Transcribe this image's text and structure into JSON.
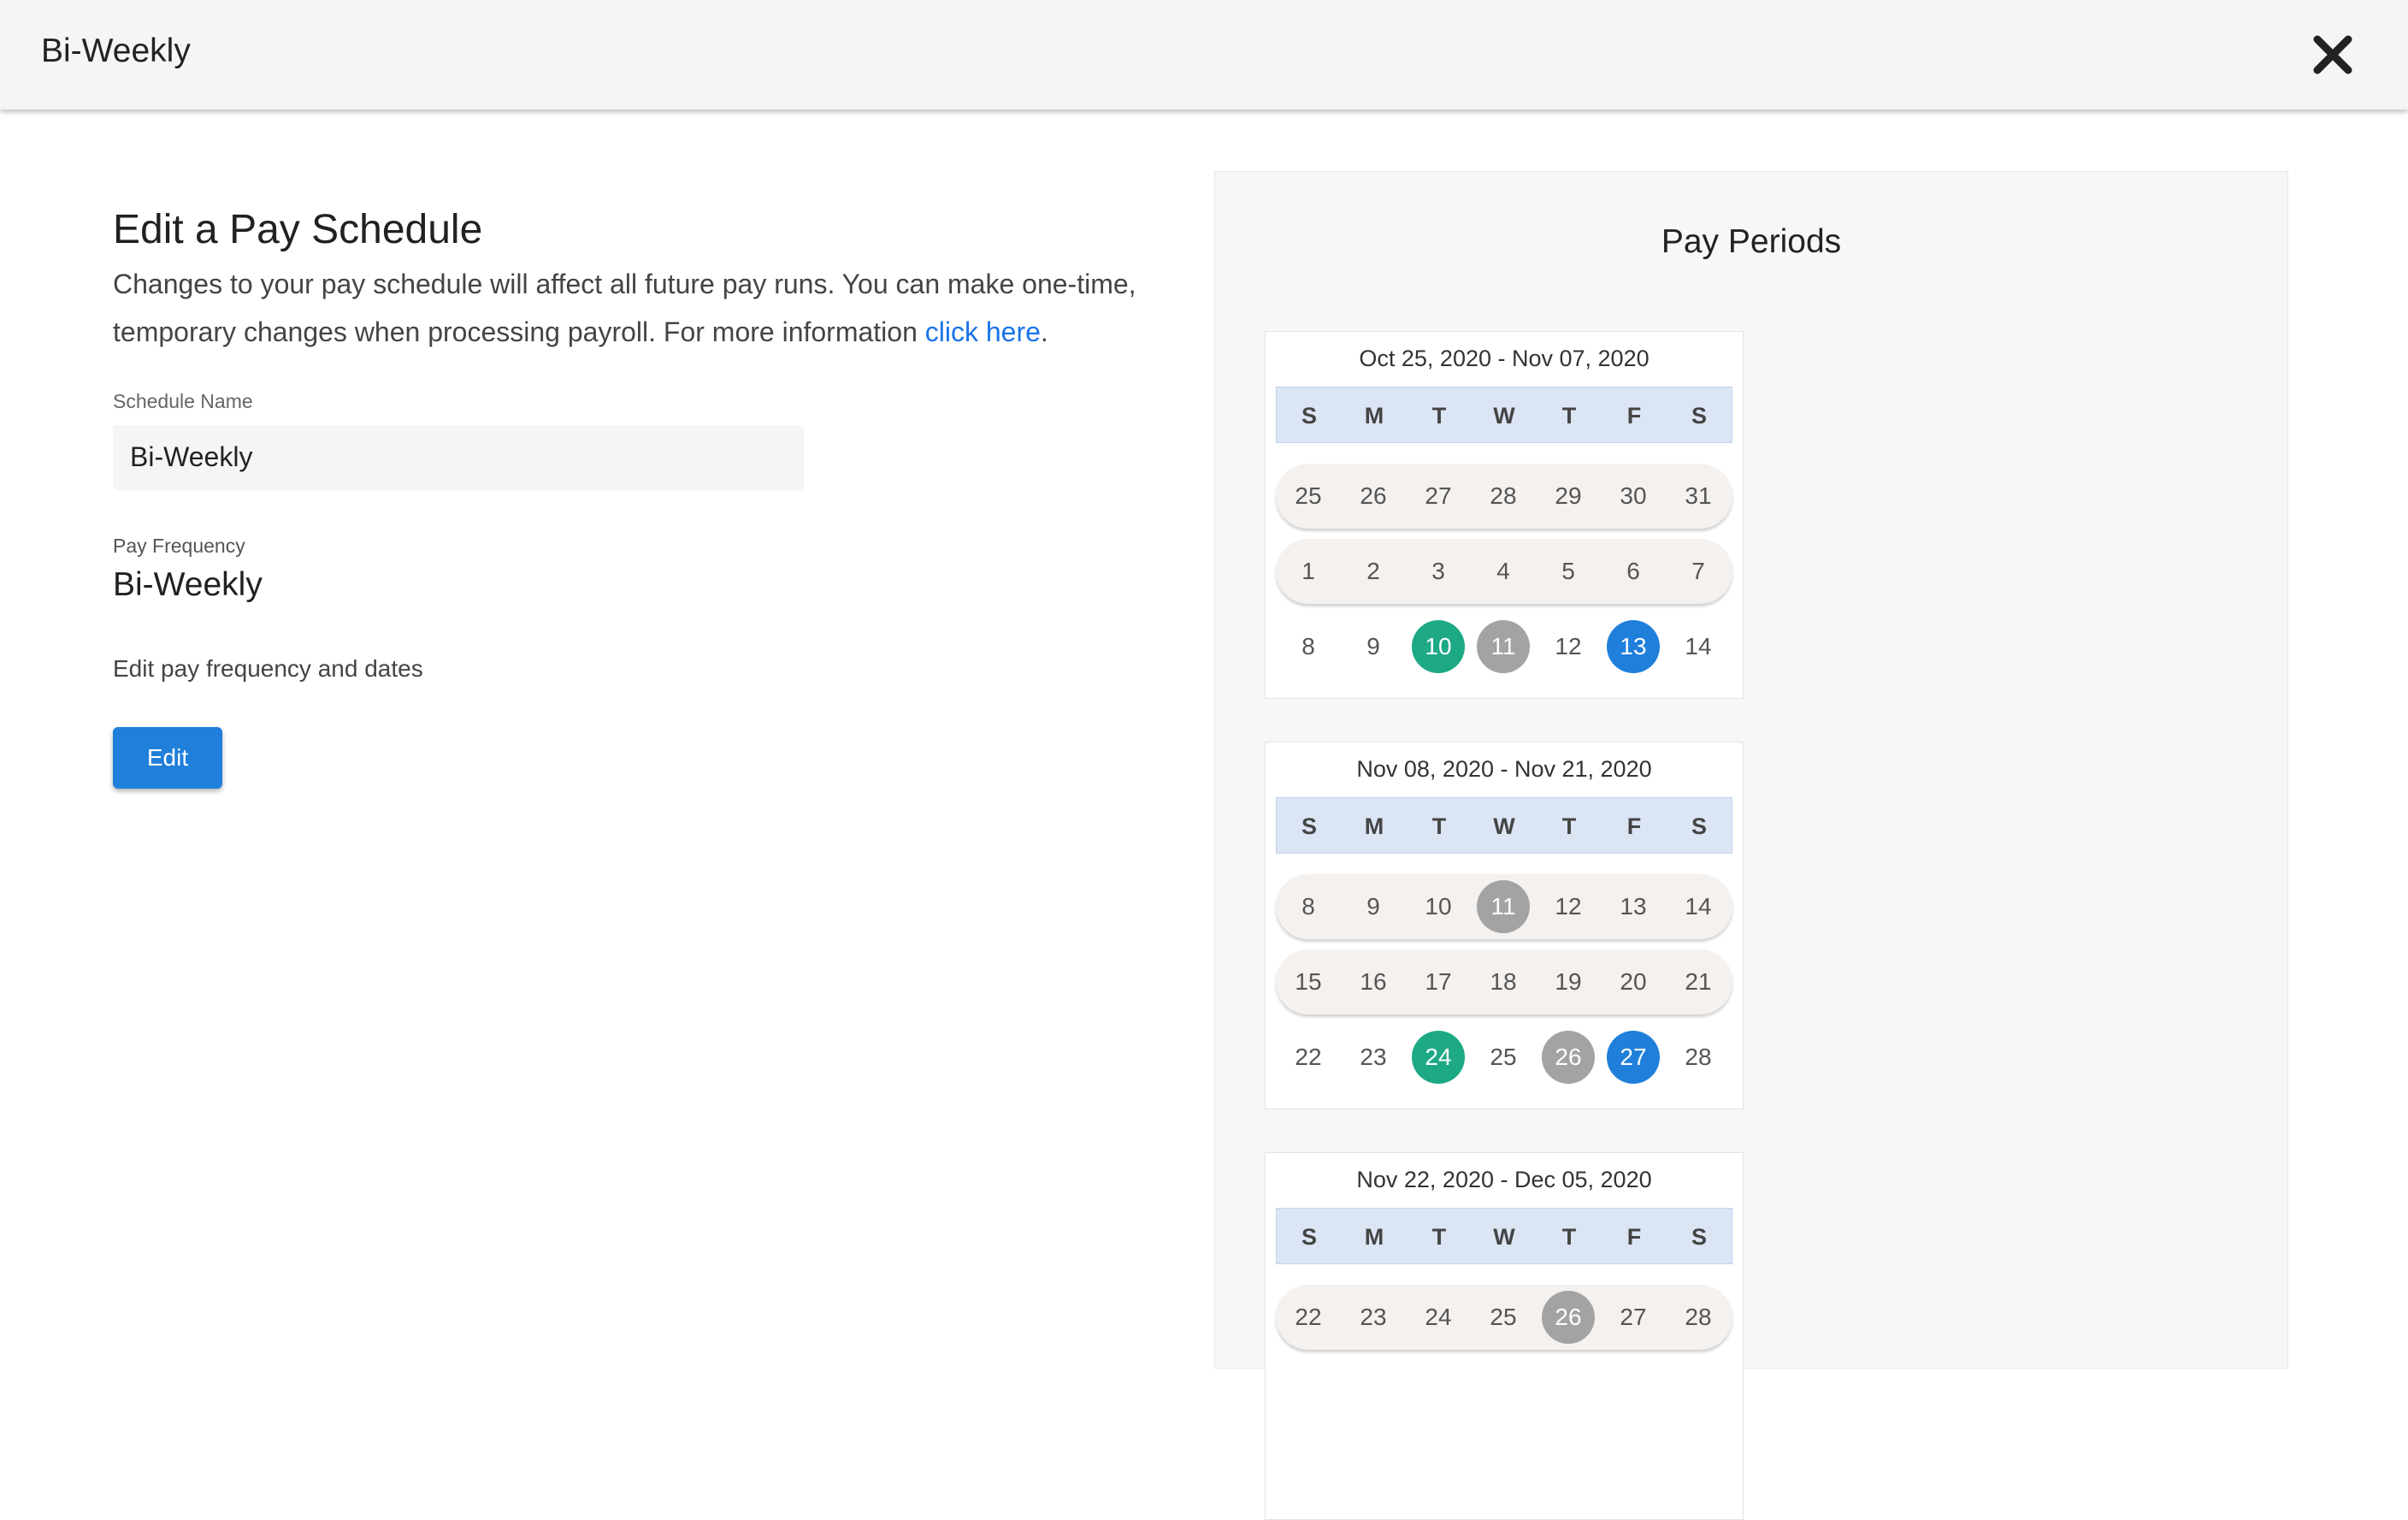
{
  "header": {
    "title": "Bi-Weekly"
  },
  "form": {
    "title": "Edit a Pay Schedule",
    "description": "Changes to your pay schedule will affect all future pay runs. You can make one-time, temporary changes when processing payroll. For more information ",
    "link_text": "click here",
    "link_suffix": ".",
    "schedule_name_label": "Schedule Name",
    "schedule_name_value": "Bi-Weekly",
    "pay_frequency_label": "Pay Frequency",
    "pay_frequency_value": "Bi-Weekly",
    "edit_description": "Edit pay frequency and dates",
    "edit_button_label": "Edit"
  },
  "panel": {
    "title": "Pay Periods",
    "weekdays": [
      "S",
      "M",
      "T",
      "W",
      "T",
      "F",
      "S"
    ],
    "colors": {
      "pay_date": "#1ea985",
      "holiday": "#a3a3a3",
      "period_end": "#1f7fdb"
    },
    "calendars": [
      {
        "range": "Oct 25, 2020 - Nov 07, 2020",
        "weeks": [
          {
            "shaded": true,
            "days": [
              {
                "n": "25"
              },
              {
                "n": "26"
              },
              {
                "n": "27"
              },
              {
                "n": "28"
              },
              {
                "n": "29"
              },
              {
                "n": "30"
              },
              {
                "n": "31"
              }
            ]
          },
          {
            "shaded": true,
            "days": [
              {
                "n": "1"
              },
              {
                "n": "2"
              },
              {
                "n": "3"
              },
              {
                "n": "4"
              },
              {
                "n": "5"
              },
              {
                "n": "6"
              },
              {
                "n": "7"
              }
            ]
          },
          {
            "shaded": false,
            "days": [
              {
                "n": "8"
              },
              {
                "n": "9"
              },
              {
                "n": "10",
                "m": "green"
              },
              {
                "n": "11",
                "m": "gray"
              },
              {
                "n": "12"
              },
              {
                "n": "13",
                "m": "blue"
              },
              {
                "n": "14"
              }
            ]
          }
        ]
      },
      {
        "range": "Nov 08, 2020 - Nov 21, 2020",
        "weeks": [
          {
            "shaded": true,
            "days": [
              {
                "n": "8"
              },
              {
                "n": "9"
              },
              {
                "n": "10"
              },
              {
                "n": "11",
                "m": "gray"
              },
              {
                "n": "12"
              },
              {
                "n": "13"
              },
              {
                "n": "14"
              }
            ]
          },
          {
            "shaded": true,
            "days": [
              {
                "n": "15"
              },
              {
                "n": "16"
              },
              {
                "n": "17"
              },
              {
                "n": "18"
              },
              {
                "n": "19"
              },
              {
                "n": "20"
              },
              {
                "n": "21"
              }
            ]
          },
          {
            "shaded": false,
            "days": [
              {
                "n": "22"
              },
              {
                "n": "23"
              },
              {
                "n": "24",
                "m": "green"
              },
              {
                "n": "25"
              },
              {
                "n": "26",
                "m": "gray"
              },
              {
                "n": "27",
                "m": "blue"
              },
              {
                "n": "28"
              }
            ]
          }
        ]
      },
      {
        "range": "Nov 22, 2020 - Dec 05, 2020",
        "weeks": [
          {
            "shaded": true,
            "days": [
              {
                "n": "22"
              },
              {
                "n": "23"
              },
              {
                "n": "24"
              },
              {
                "n": "25"
              },
              {
                "n": "26",
                "m": "gray"
              },
              {
                "n": "27"
              },
              {
                "n": "28"
              }
            ]
          }
        ]
      }
    ]
  }
}
